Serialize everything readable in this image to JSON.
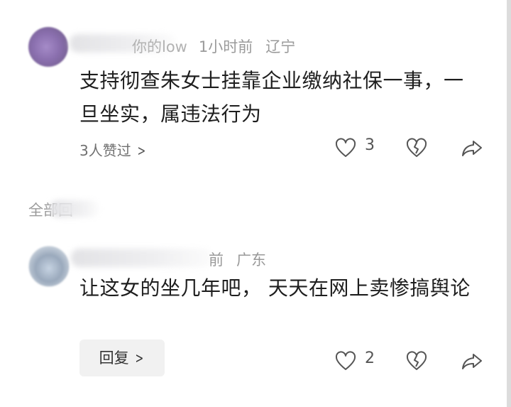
{
  "comments": [
    {
      "username_visible": "你的low",
      "time": "1小时前",
      "location": "辽宁",
      "text": "支持彻查朱女士挂靠企业缴纳社保一事，一旦坐实，属违法行为",
      "likers_label": "3人赞过",
      "like_count": "3"
    },
    {
      "username_visible": "",
      "time": "前",
      "location": "广东",
      "text": "让这女的坐几年吧， 天天在网上卖惨搞舆论",
      "reply_label": "回复",
      "like_count": "2"
    }
  ],
  "section": {
    "label": "全部回"
  },
  "icons": {
    "like": "heart-outline-icon",
    "dislike": "broken-heart-icon",
    "share": "share-arrow-icon",
    "chevron": "chevron-right-icon"
  },
  "colors": {
    "meta_text": "#9a9a9a",
    "body_text": "#1e1e1e",
    "reply_button_bg": "#f1f1f1"
  }
}
